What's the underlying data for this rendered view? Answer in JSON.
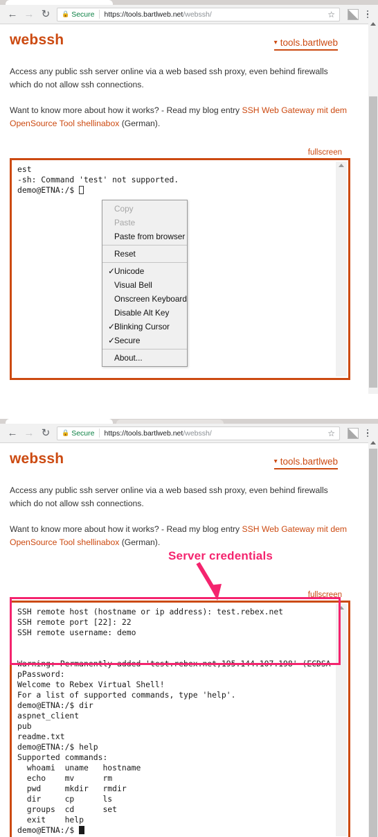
{
  "browser": {
    "back_icon": "arrow-left-icon",
    "forward_icon": "arrow-right-icon",
    "reload_icon": "reload-icon",
    "lock_icon": "lock-icon",
    "secure_label": "Secure",
    "url_scheme_host": "https://tools.bartlweb.net",
    "url_path": "/webssh/",
    "star_icon": "star-icon",
    "extension_icon": "extension-icon",
    "menu_icon": "kebab-menu-icon"
  },
  "site": {
    "title": "webssh",
    "nav_label": "tools.bartlweb",
    "nav_chevron": "chevron-down-icon",
    "paragraph1": "Access any public ssh server online via a web based ssh proxy, even behind firewalls which do not allow ssh connections.",
    "paragraph2_pre": "Want to know more about how it works? - Read my blog entry ",
    "paragraph2_link": "SSH Web Gateway mit dem OpenSource Tool shellinabox",
    "paragraph2_post": " (German).",
    "fullscreen_label": "fullscreen",
    "accent_color": "#cc4a11"
  },
  "panel1": {
    "terminal_lines": "est\n-sh: Command 'test' not supported.\ndemo@ETNA:/$ ",
    "context_menu": {
      "groups": [
        [
          {
            "label": "Copy",
            "disabled": true,
            "checked": false
          },
          {
            "label": "Paste",
            "disabled": true,
            "checked": false
          },
          {
            "label": "Paste from browser",
            "disabled": false,
            "checked": false
          }
        ],
        [
          {
            "label": "Reset",
            "disabled": false,
            "checked": false
          }
        ],
        [
          {
            "label": "Unicode",
            "disabled": false,
            "checked": true
          },
          {
            "label": "Visual Bell",
            "disabled": false,
            "checked": false
          },
          {
            "label": "Onscreen Keyboard",
            "disabled": false,
            "checked": false
          },
          {
            "label": "Disable Alt Key",
            "disabled": false,
            "checked": false
          },
          {
            "label": "Blinking Cursor",
            "disabled": false,
            "checked": true
          },
          {
            "label": "Secure",
            "disabled": false,
            "checked": true
          }
        ],
        [
          {
            "label": "About...",
            "disabled": false,
            "checked": false
          }
        ]
      ]
    }
  },
  "panel2": {
    "annotation_label": "Server credentials",
    "annotation_color": "#f4246e",
    "terminal_credentials": "SSH remote host (hostname or ip address): test.rebex.net\nSSH remote port [22]: 22\nSSH remote username: demo\n\n\nWarning: Permanently added 'test.rebex.net,195.144.107.198' (ECDSA\npPassword:",
    "terminal_session": "Welcome to Rebex Virtual Shell!\nFor a list of supported commands, type 'help'.\ndemo@ETNA:/$ dir\naspnet_client\npub\nreadme.txt\ndemo@ETNA:/$ help\nSupported commands:\n  whoami  uname   hostname\n  echo    mv      rm\n  pwd     mkdir   rmdir\n  dir     cp      ls\n  groups  cd      set\n  exit    help\ndemo@ETNA:/$ "
  }
}
